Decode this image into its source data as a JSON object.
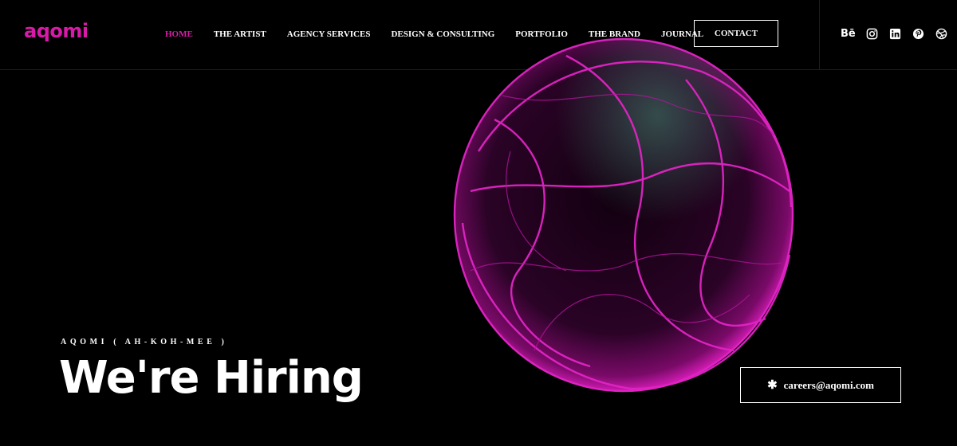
{
  "brand": {
    "logo_text": "aqomi",
    "accent_color": "#d91aa8"
  },
  "nav": {
    "items": [
      {
        "label": "HOME",
        "active": true
      },
      {
        "label": "THE ARTIST",
        "active": false
      },
      {
        "label": "AGENCY SERVICES",
        "active": false
      },
      {
        "label": "DESIGN & CONSULTING",
        "active": false
      },
      {
        "label": "PORTFOLIO",
        "active": false
      },
      {
        "label": "THE BRAND",
        "active": false
      },
      {
        "label": "JOURNAL",
        "active": false
      }
    ],
    "contact_label": "CONTACT"
  },
  "social": {
    "behance_label": "Bē",
    "icons": [
      "behance-icon",
      "instagram-icon",
      "linkedin-icon",
      "pinterest-icon",
      "dribbble-icon"
    ]
  },
  "hero": {
    "eyebrow": "AQOMI ( AH-KOH-MEE )",
    "headline": "We're Hiring",
    "email_icon": "asterisk-icon",
    "email": "careers@aqomi.com"
  }
}
